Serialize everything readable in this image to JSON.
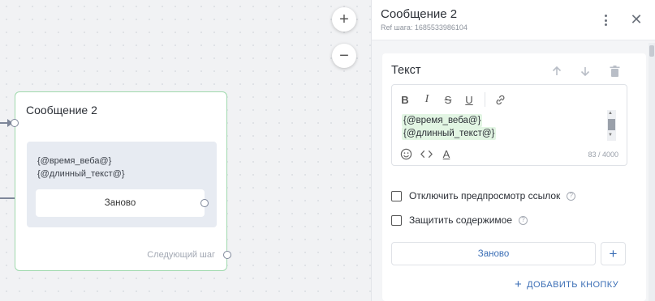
{
  "canvas": {
    "zoom_in": "+",
    "zoom_out": "−",
    "node": {
      "title": "Сообщение 2",
      "message_line1": "{@время_веба@}",
      "message_line2": "{@длинный_текст@}",
      "button_label": "Заново",
      "next_step": "Следующий шаг"
    }
  },
  "panel": {
    "title": "Сообщение 2",
    "ref": "Ref шага: 1685533986104",
    "card": {
      "title": "Текст",
      "editor": {
        "toolbar": {
          "bold": "B",
          "italic": "I",
          "strike": "S",
          "underline": "U"
        },
        "line1": "{@время_веба@}",
        "line2": "{@длинный_текст@}",
        "counter": "83 / 4000",
        "color_label": "A"
      },
      "option_disable_preview": "Отключить предпросмотр ссылок",
      "option_protect": "Защитить содержимое",
      "button_label": "Заново",
      "add_button": "ДОБАВИТЬ КНОПКУ"
    }
  },
  "colors": {
    "accent": "#3c6fb6",
    "node_border": "#9fd9ad",
    "variable_highlight": "#e2f5e3"
  }
}
